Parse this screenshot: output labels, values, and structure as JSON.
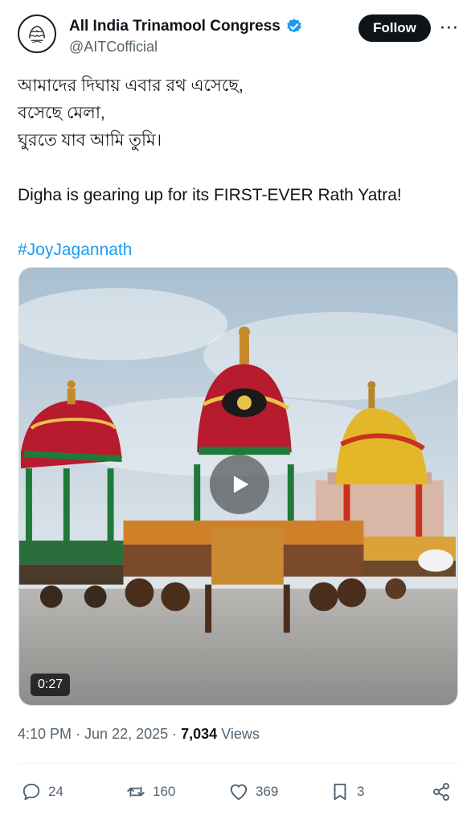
{
  "author": {
    "display_name": "All India Trinamool Congress",
    "handle": "@AITCofficial",
    "verified_icon": "verified-badge-icon",
    "avatar_icon": "aitc-logo-icon"
  },
  "header": {
    "follow_label": "Follow",
    "more_label": "···"
  },
  "tweet": {
    "lines": [
      "আমাদের দিঘায় এবার রথ এসেছে,",
      "বসেছে মেলা,",
      "ঘুরতে যাব আমি তুমি।",
      "Digha is gearing up for its FIRST-EVER Rath Yatra!",
      "#JoyJagannath"
    ]
  },
  "media": {
    "type": "video",
    "duration": "0:27",
    "play_icon": "play-icon"
  },
  "meta": {
    "time": "4:10 PM",
    "sep1": " · ",
    "date": "Jun 22, 2025",
    "sep2": " · ",
    "views_count": "7,034",
    "views_label": " Views"
  },
  "actions": {
    "replies": "24",
    "reposts": "160",
    "likes": "369",
    "bookmarks": "3"
  },
  "colors": {
    "text": "#0f1419",
    "secondary": "#536471",
    "accent": "#1d9bf0",
    "follow_bg": "#0f1419"
  }
}
